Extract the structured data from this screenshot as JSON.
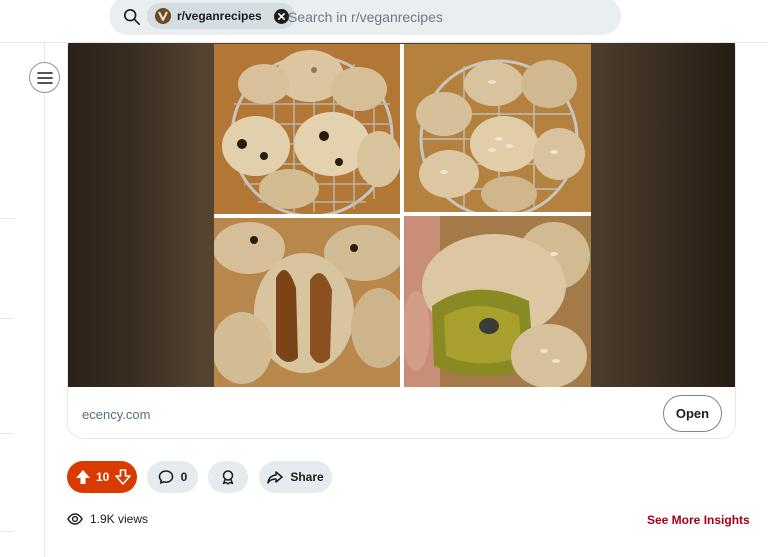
{
  "search": {
    "community_chip": "r/veganrecipes",
    "placeholder": "Search in r/veganrecipes"
  },
  "post": {
    "link_domain": "ecency.com",
    "open_label": "Open",
    "media_description": "Collage of four photos of homemade seeded buns on a cooling rack"
  },
  "actions": {
    "vote_count": "10",
    "comment_count": "0",
    "share_label": "Share"
  },
  "insights": {
    "views": "1.9K views",
    "see_more": "See More Insights"
  },
  "colors": {
    "upvote_bg": "#d93a00",
    "insights_link": "#a3001c",
    "search_bg": "#e9eef0"
  },
  "icons": [
    "search-icon",
    "community-avatar-icon",
    "clear-icon",
    "menu-icon",
    "upvote-icon",
    "downvote-icon",
    "comment-icon",
    "award-icon",
    "share-icon",
    "views-icon"
  ]
}
